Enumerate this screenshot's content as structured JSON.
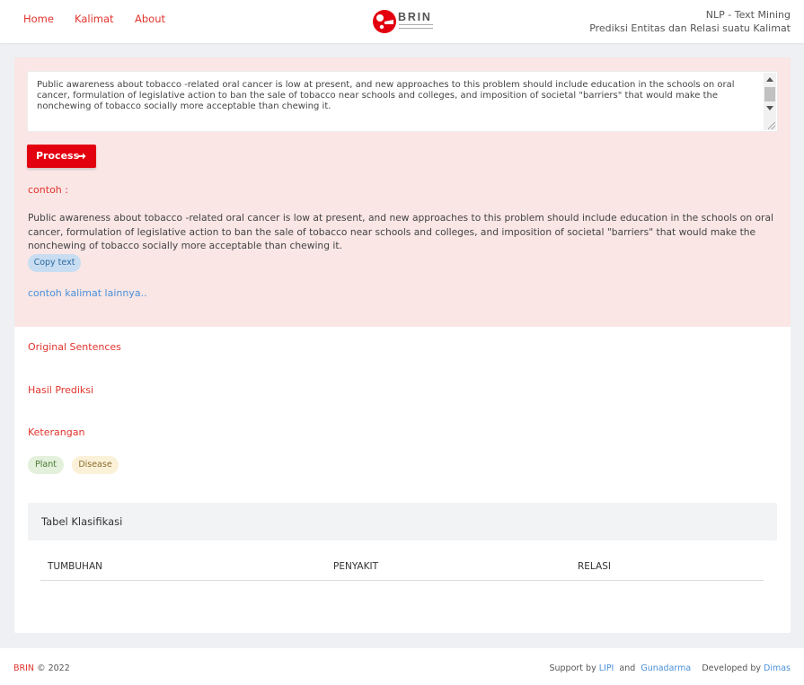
{
  "nav": {
    "links": [
      "Home",
      "Kalimat",
      "About"
    ],
    "brand_name": "BRIN",
    "title_line1": "NLP - Text Mining",
    "title_line2": "Prediksi Entitas dan Relasi suatu Kalimat"
  },
  "input": {
    "value": "Public awareness about tobacco -related oral cancer is low at present, and new approaches to this problem should include education in the schools on oral cancer, formulation of legislative action to ban the sale of tobacco near schools and colleges, and imposition of societal \"barriers\" that would make the nonchewing of tobacco socially more acceptable than chewing it."
  },
  "process_button": "Process",
  "example": {
    "label": "contoh :",
    "text": "Public awareness about tobacco -related oral cancer is low at present, and new approaches to this problem should include education in the schools on oral cancer, formulation of legislative action to ban the sale of tobacco near schools and colleges, and imposition of societal \"barriers\" that would make the nonchewing of tobacco socially more acceptable than chewing it.",
    "copy_button": "Copy text",
    "more_link": "contoh kalimat lainnya.."
  },
  "sections": {
    "original": "Original Sentences",
    "prediction": "Hasil Prediksi",
    "legend": "Keterangan"
  },
  "legend": {
    "plant": "Plant",
    "disease": "Disease",
    "plant_color": "#e3f0db",
    "disease_color": "#fbf1d8"
  },
  "table": {
    "title": "Tabel Klasifikasi",
    "columns": [
      "TUMBUHAN",
      "PENYAKIT",
      "RELASI"
    ]
  },
  "footer": {
    "brand": "BRIN",
    "copyright": "© 2022",
    "support_prefix": "Support by",
    "support_1": "LIPI",
    "and": "and",
    "support_2": "Gunadarma",
    "developed_prefix": "Developed by",
    "developer": "Dimas"
  },
  "colors": {
    "accent": "#e3000f",
    "link": "#e0342c",
    "panel": "#f9e6e5"
  },
  "icons": [
    "brin-logo",
    "arrow-right-icon"
  ]
}
